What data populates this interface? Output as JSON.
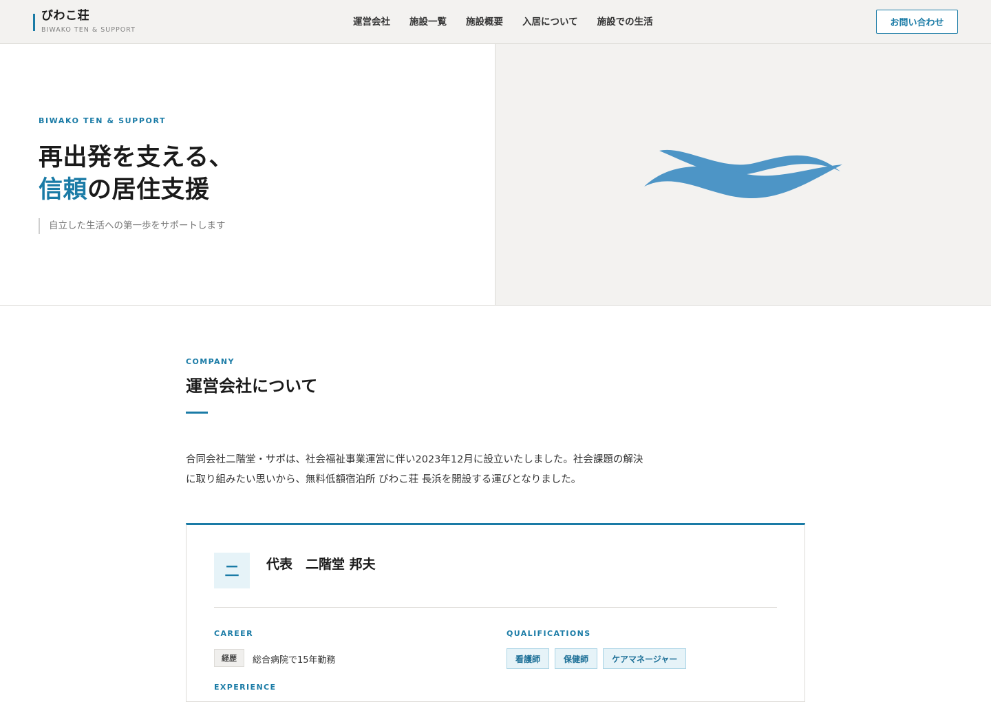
{
  "header": {
    "brand_name": "びわこ荘",
    "brand_sub": "BIWAKO TEN & SUPPORT",
    "nav": [
      {
        "label": "運営会社"
      },
      {
        "label": "施設一覧"
      },
      {
        "label": "施設概要"
      },
      {
        "label": "入居について"
      },
      {
        "label": "施設での生活"
      }
    ],
    "contact_label": "お問い合わせ"
  },
  "hero": {
    "eyebrow": "BIWAKO TEN & SUPPORT",
    "title_line1": "再出発を支える、",
    "title_accent": "信頼",
    "title_line2_rest": "の居住支援",
    "subtitle": "自立した生活への第一歩をサポートします",
    "wave_icon": "wave-logo-icon",
    "accent_color": "#1a7ba6",
    "wave_color": "#4d95c6"
  },
  "company": {
    "eyebrow": "COMPANY",
    "title": "運営会社について",
    "body_line1": "合同会社二階堂・サポは、社会福祉事業運営に伴い2023年12月に設立いたしました。社会課題の解決",
    "body_line2": "に取り組みたい思いから、無料低額宿泊所 びわこ荘 長浜を開設する運びとなりました。",
    "profile": {
      "avatar_text": "二",
      "name": "代表　二階堂 邦夫",
      "career_label": "CAREER",
      "career_tag": "経歴",
      "career_text": "総合病院で15年勤務",
      "experience_label": "EXPERIENCE",
      "qualifications_label": "QUALIFICATIONS",
      "qualifications": [
        "看護師",
        "保健師",
        "ケアマネージャー"
      ]
    }
  }
}
